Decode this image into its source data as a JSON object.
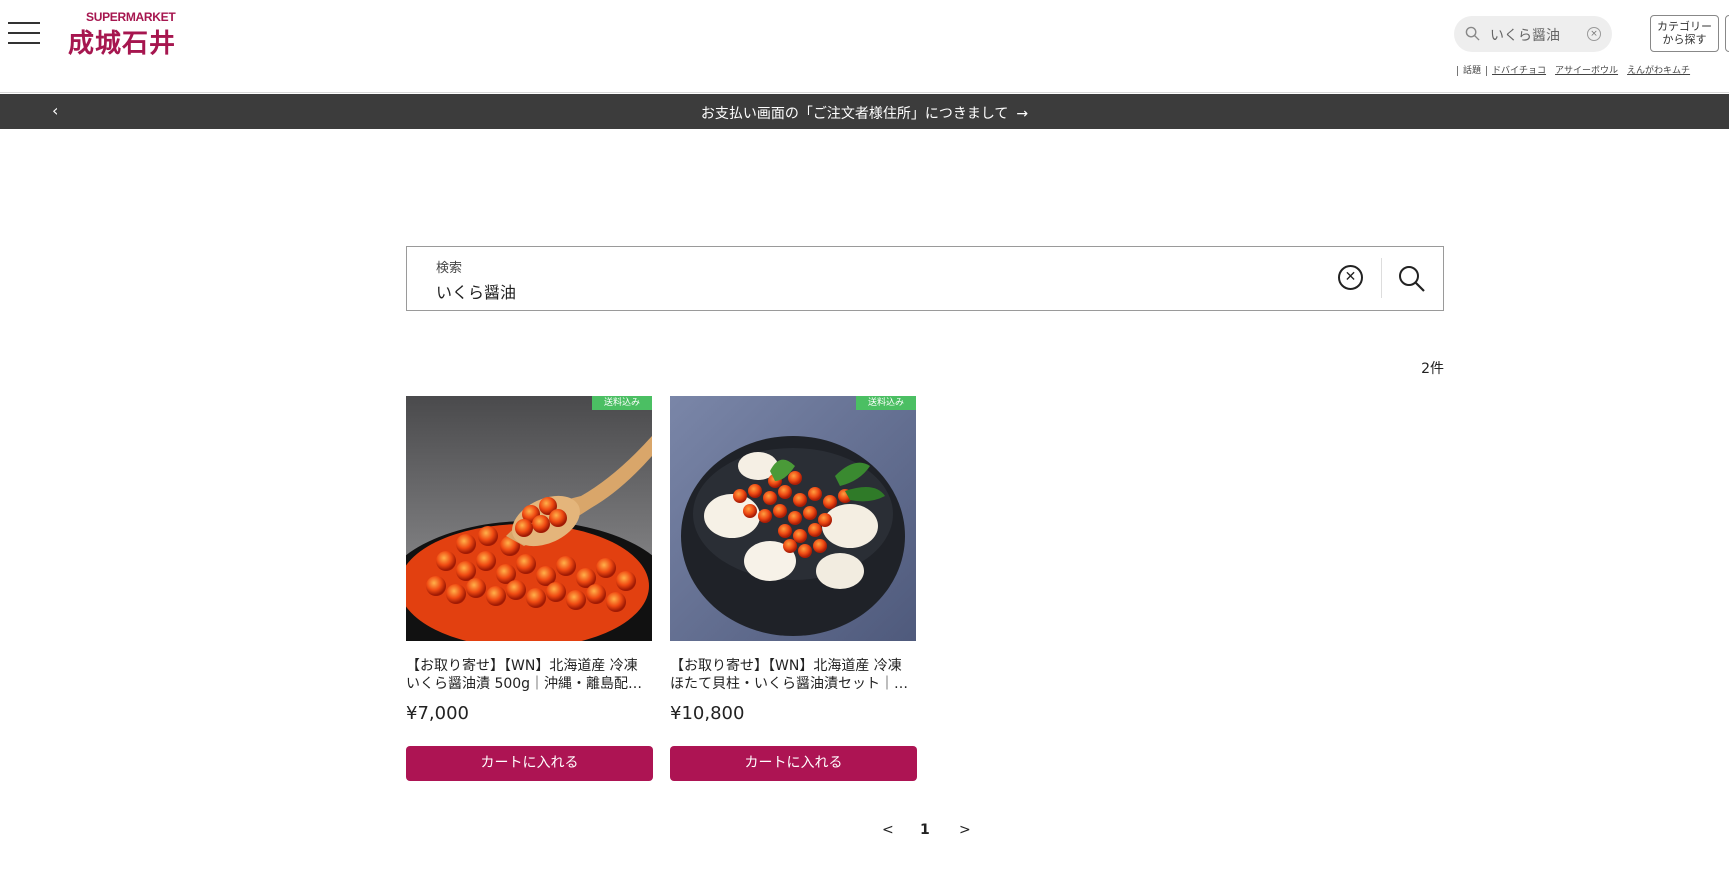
{
  "header": {
    "logo_top": "SUPERMARKET",
    "logo_main": "成城石井",
    "search_value": "いくら醤油",
    "category_button": "カテゴリー\nから探す",
    "keyword_links": [
      "話題",
      "ドバイチョコ",
      "アサイーボウル",
      "えんがわキムチ"
    ]
  },
  "notice": {
    "prev_label": "‹",
    "text": "お支払い画面の「ご注文者様住所」につきまして",
    "arrow": "→"
  },
  "search": {
    "label": "検索",
    "value": "いくら醤油",
    "clear_label": "✕"
  },
  "results": {
    "count": "2件"
  },
  "products": [
    {
      "badge": "送料込み",
      "name_line1": "【お取り寄せ】【WN】北海道産 冷凍",
      "name_line2": "いくら醤油漬 500g｜沖縄・離島配…",
      "price": "¥7,000",
      "cart_label": "カートに入れる"
    },
    {
      "badge": "送料込み",
      "name_line1": "【お取り寄せ】【WN】北海道産 冷凍",
      "name_line2": "ほたて貝柱・いくら醤油漬セット｜…",
      "price": "¥10,800",
      "cart_label": "カートに入れる"
    }
  ],
  "pagination": {
    "prev": "<",
    "current": "1",
    "next": ">"
  },
  "colors": {
    "brand": "#ad1453",
    "notice_bg": "#3c3c3c",
    "badge": "#4bbf63"
  }
}
